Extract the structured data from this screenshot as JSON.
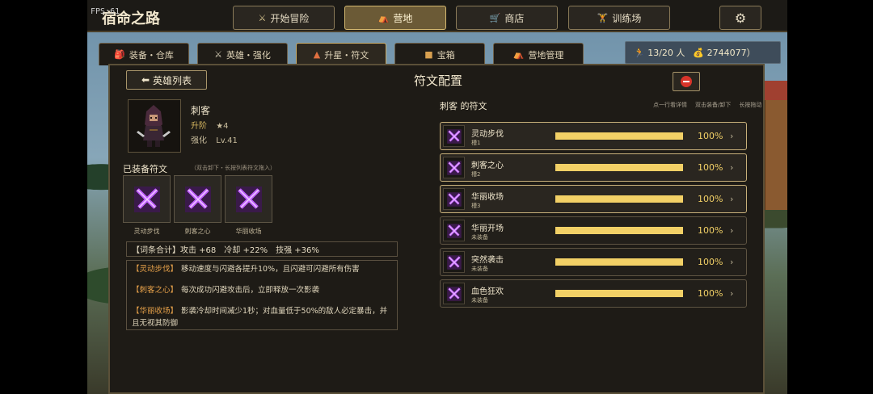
{
  "fps_label": "FPS:61",
  "game_title": "宿命之路",
  "nav": [
    {
      "label": "开始冒险",
      "icon": "⚔",
      "active": false
    },
    {
      "label": "营地",
      "icon": "⛺",
      "active": true
    },
    {
      "label": "商店",
      "icon": "🛒",
      "active": false
    },
    {
      "label": "训练场",
      "icon": "🏋",
      "active": false
    }
  ],
  "settings_icon": "gear-icon",
  "subtabs": [
    {
      "label": "装备・仓库",
      "icon": "backpack-icon"
    },
    {
      "label": "英雄・强化",
      "icon": "swords-icon"
    },
    {
      "label": "升星・符文",
      "icon": "flame-icon"
    },
    {
      "label": "宝箱",
      "icon": "chest-icon"
    },
    {
      "label": "营地管理",
      "icon": "tent-icon"
    }
  ],
  "resources": {
    "people": "13/20 人",
    "gold": "2744077）"
  },
  "panel": {
    "title": "符文配置",
    "back_label": "英雄列表"
  },
  "hero": {
    "name": "刺客",
    "rank_label": "升阶",
    "rank_value": "★4",
    "enhance_label": "强化",
    "enhance_value": "Lv.41"
  },
  "equipped": {
    "title": "已装备符文",
    "hint": "（双击卸下・长按列表符文拖入）",
    "slots": [
      "灵动步伐",
      "刺客之心",
      "华丽收场"
    ]
  },
  "totals": "【词条合计】攻击 +68　冷却 +22%　技强 +36%",
  "descriptions": [
    {
      "name": "【灵动步伐】",
      "text": "移动速度与闪避各提升10%，且闪避可闪避所有伤害"
    },
    {
      "name": "【刺客之心】",
      "text": "每次成功闪避攻击后，立即释放一次影袭"
    },
    {
      "name": "【华丽收场】",
      "text": "影袭冷却时间减少1秒；对血量低于50%的敌人必定暴击，并且无视其防御"
    }
  ],
  "rune_list": {
    "title": "刺客 的符文",
    "hints": [
      "点一行看详情",
      "双击装备/卸下",
      "长按拖动"
    ],
    "items": [
      {
        "name": "灵动步伐",
        "status": "槽1",
        "progress": 100,
        "percent": "100%",
        "equipped": true
      },
      {
        "name": "刺客之心",
        "status": "槽2",
        "progress": 100,
        "percent": "100%",
        "equipped": true
      },
      {
        "name": "华丽收场",
        "status": "槽3",
        "progress": 100,
        "percent": "100%",
        "equipped": true
      },
      {
        "name": "华丽开场",
        "status": "未装备",
        "progress": 100,
        "percent": "100%",
        "equipped": false
      },
      {
        "name": "突然袭击",
        "status": "未装备",
        "progress": 100,
        "percent": "100%",
        "equipped": false
      },
      {
        "name": "血色狂欢",
        "status": "未装备",
        "progress": 100,
        "percent": "100%",
        "equipped": false
      }
    ],
    "chevron": "›"
  }
}
